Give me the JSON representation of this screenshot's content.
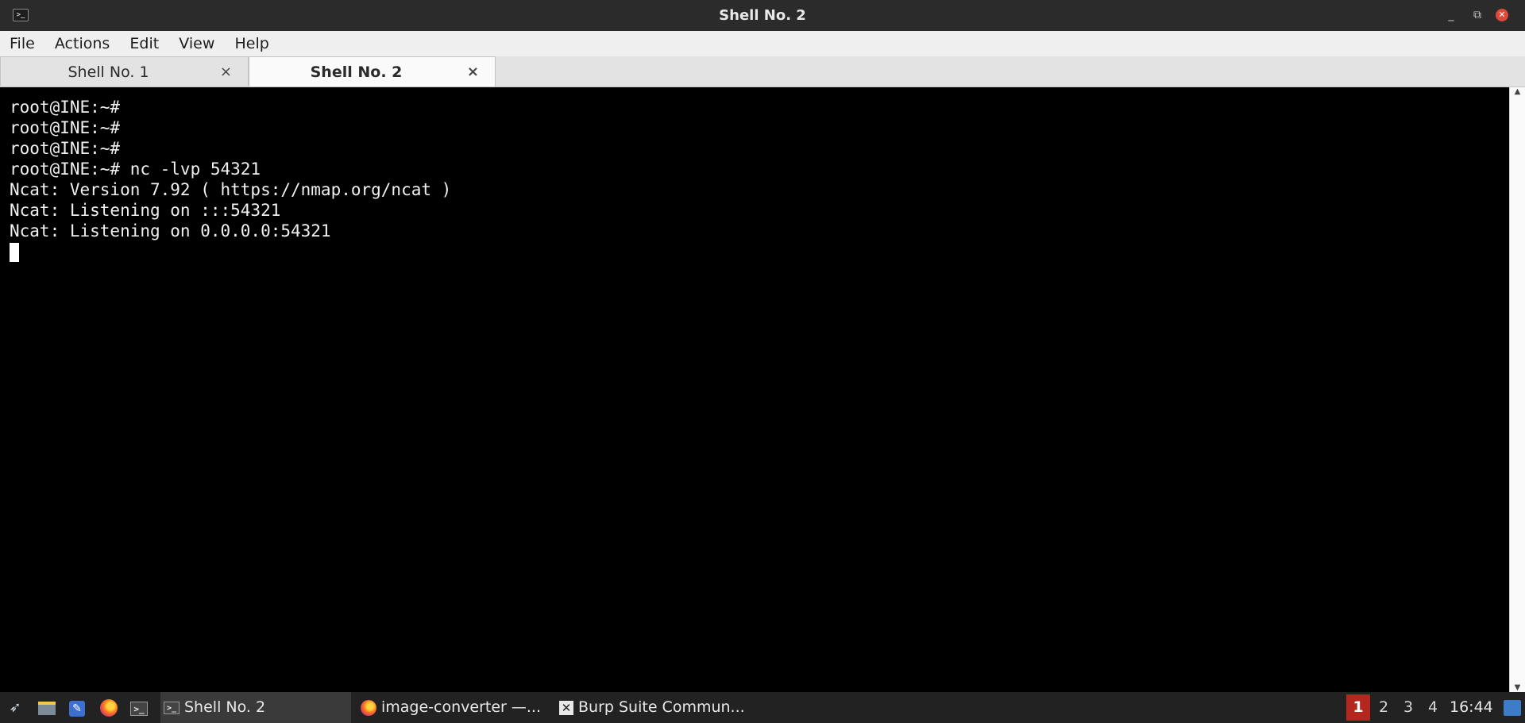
{
  "window": {
    "title": "Shell No. 2",
    "controls": {
      "minimize": "_",
      "maximize": "⧉",
      "close": "✕"
    }
  },
  "menubar": {
    "items": [
      "File",
      "Actions",
      "Edit",
      "View",
      "Help"
    ]
  },
  "tabs": [
    {
      "label": "Shell No. 1",
      "active": false,
      "close": "×"
    },
    {
      "label": "Shell No. 2",
      "active": true,
      "close": "×"
    }
  ],
  "terminal": {
    "lines": [
      "root@INE:~#",
      "root@INE:~#",
      "root@INE:~#",
      "root@INE:~# nc -lvp 54321",
      "Ncat: Version 7.92 ( https://nmap.org/ncat )",
      "Ncat: Listening on :::54321",
      "Ncat: Listening on 0.0.0.0:54321"
    ]
  },
  "taskbar": {
    "launchers": [
      "kali-menu-icon",
      "files-icon",
      "text-editor-icon",
      "firefox-icon",
      "terminal-icon"
    ],
    "tasks": [
      {
        "label": "Shell No. 2",
        "icon": "terminal-icon"
      },
      {
        "label": "image-converter —...",
        "icon": "firefox-icon"
      },
      {
        "label": "Burp Suite Commun...",
        "icon": "burp-icon"
      }
    ],
    "workspaces": [
      "1",
      "2",
      "3",
      "4"
    ],
    "active_workspace": "1",
    "clock": "16:44"
  },
  "colors": {
    "terminal_bg": "#000000",
    "terminal_fg": "#f0f0f0",
    "active_workspace": "#b3271f",
    "taskbar_bg": "#222222"
  }
}
